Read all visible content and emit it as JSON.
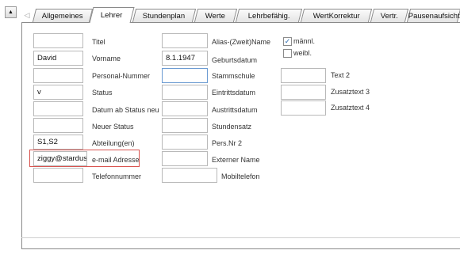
{
  "tabs": {
    "back_arrow": "◁",
    "items": [
      {
        "label": "Allgemeines"
      },
      {
        "label": "Lehrer"
      },
      {
        "label": "Stundenplan"
      },
      {
        "label": "Werte"
      },
      {
        "label": "Lehrbefähig."
      },
      {
        "label": "WertKorrektur"
      },
      {
        "label": "Vertr."
      },
      {
        "label": "Pausenaufsicht"
      }
    ],
    "active": "Lehrer"
  },
  "scroll_up_glyph": "▲",
  "left_fields": [
    {
      "label": "Titel",
      "value": ""
    },
    {
      "label": "Vorname",
      "value": "David"
    },
    {
      "label": "Personal-Nummer",
      "value": ""
    },
    {
      "label": "Status",
      "value": "v"
    },
    {
      "label": "Datum ab Status neu",
      "value": ""
    },
    {
      "label": "Neuer Status",
      "value": ""
    },
    {
      "label": "Abteilung(en)",
      "value": "S1,S2"
    },
    {
      "label": "e-mail Adresse",
      "value": "ziggy@stardust.u"
    },
    {
      "label": "Telefonnummer",
      "value": ""
    }
  ],
  "middle_fields": [
    {
      "label": "Alias-(Zweit)Name",
      "value": ""
    },
    {
      "label": "Geburtsdatum",
      "value": "8.1.1947"
    },
    {
      "label": "Stammschule",
      "value": ""
    },
    {
      "label": "Eintrittsdatum",
      "value": ""
    },
    {
      "label": "Austrittsdatum",
      "value": ""
    },
    {
      "label": "Stundensatz",
      "value": ""
    },
    {
      "label": "Pers.Nr 2",
      "value": ""
    },
    {
      "label": "Externer Name",
      "value": ""
    },
    {
      "label": "Mobiltelefon",
      "value": ""
    }
  ],
  "gender": {
    "male": {
      "label": "männl.",
      "checked": true,
      "mark": "✓"
    },
    "female": {
      "label": "weibl.",
      "checked": false,
      "mark": ""
    }
  },
  "right_fields": [
    {
      "label": "Text 2",
      "value": ""
    },
    {
      "label": "Zusatztext 3",
      "value": ""
    },
    {
      "label": "Zusatztext 4",
      "value": ""
    }
  ],
  "colors": {
    "highlight": "#d9534f",
    "focus": "#6b9bd2",
    "check": "#2a6ab0"
  }
}
